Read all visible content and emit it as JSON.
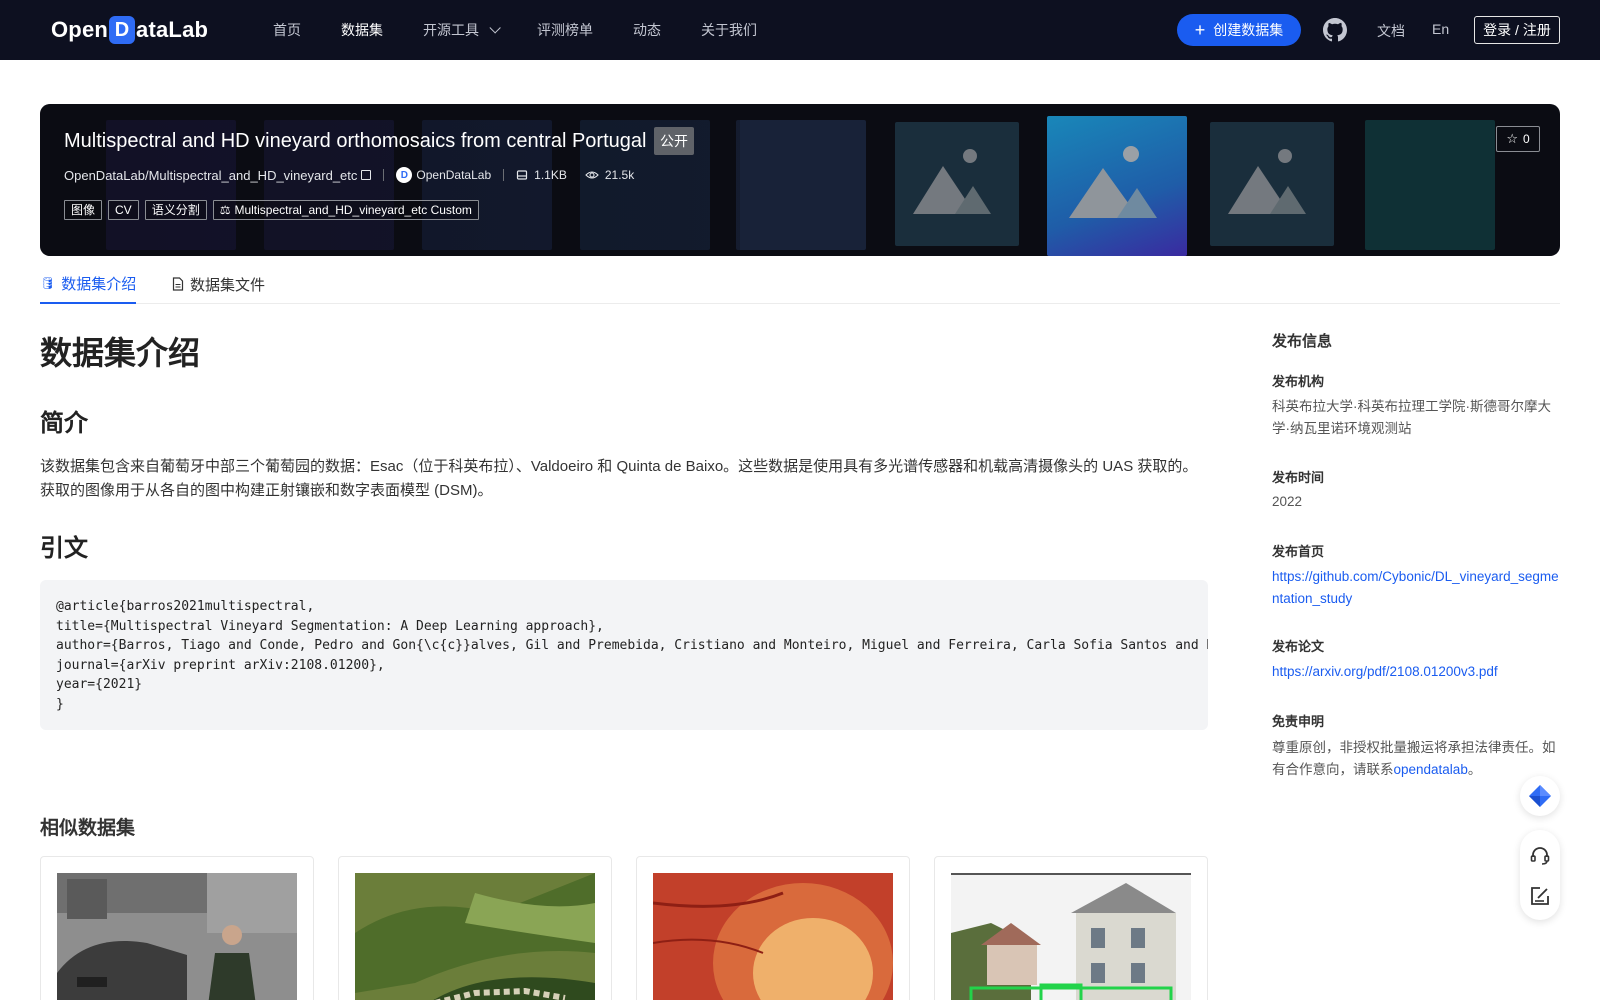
{
  "nav": {
    "logo_prefix": "Open",
    "logo_d": "D",
    "logo_suffix": "ataLab",
    "items": [
      {
        "label": "首页"
      },
      {
        "label": "数据集"
      },
      {
        "label": "开源工具"
      },
      {
        "label": "评测榜单"
      },
      {
        "label": "动态"
      },
      {
        "label": "关于我们"
      }
    ],
    "create_label": "创建数据集",
    "docs_label": "文档",
    "lang_label": "En",
    "login_label": "登录 / 注册"
  },
  "banner": {
    "title": "Multispectral and HD vineyard orthomosaics from central Portugal",
    "visibility": "公开",
    "repo_path": "OpenDataLab/Multispectral_and_HD_vineyard_etc",
    "org_name": "OpenDataLab",
    "size": "1.1KB",
    "views": "21.5k",
    "tags": [
      "图像",
      "CV",
      "语义分割"
    ],
    "license": "Multispectral_and_HD_vineyard_etc Custom",
    "star_count": "0"
  },
  "tabs": [
    {
      "label": "数据集介绍"
    },
    {
      "label": "数据集文件"
    }
  ],
  "main": {
    "heading": "数据集介绍",
    "intro_heading": "简介",
    "intro_text": "该数据集包含来自葡萄牙中部三个葡萄园的数据：Esac（位于科英布拉）、Valdoeiro 和 Quinta de Baixo。这些数据是使用具有多光谱传感器和机载高清摄像头的 UAS 获取的。获取的图像用于从各自的图中构建正射镶嵌和数字表面模型 (DSM)。",
    "citation_heading": "引文",
    "citation": "@article{barros2021multispectral,\ntitle={Multispectral Vineyard Segmentation: A Deep Learning approach},\nauthor={Barros, Tiago and Conde, Pedro and Gon{\\c{c}}alves, Gil and Premebida, Cristiano and Monteiro, Miguel and Ferreira, Carla Sofia Santos and Nunes, Urbano J},\njournal={arXiv preprint arXiv:2108.01200},\nyear={2021}\n}",
    "similar_heading": "相似数据集"
  },
  "sidebar": {
    "title": "发布信息",
    "org_label": "发布机构",
    "org_value": "科英布拉大学·科英布拉理工学院·斯德哥尔摩大学·纳瓦里诺环境观测站",
    "time_label": "发布时间",
    "time_value": "2022",
    "home_label": "发布首页",
    "home_value": "https://github.com/Cybonic/DL_vineyard_segmentation_study",
    "paper_label": "发布论文",
    "paper_value": "https://arxiv.org/pdf/2108.01200v3.pdf",
    "disclaimer_label": "免责申明",
    "disclaimer_text": "尊重原创，非授权批量搬运将承担法律责任。如有合作意向，请联系",
    "disclaimer_link": "opendatalab",
    "disclaimer_end": "。"
  },
  "colors": {
    "nav_bg": "#0d1020",
    "accent": "#1a5cf0",
    "banner_bg": "#0b0c13"
  },
  "icons": [
    "github-icon",
    "star-icon",
    "copy-icon",
    "database-icon",
    "file-icon",
    "eye-icon",
    "disk-icon",
    "scale-icon",
    "plus-icon",
    "chevron-down-icon",
    "image-placeholder-icon",
    "support-icon",
    "edit-icon",
    "feedback-icon"
  ]
}
